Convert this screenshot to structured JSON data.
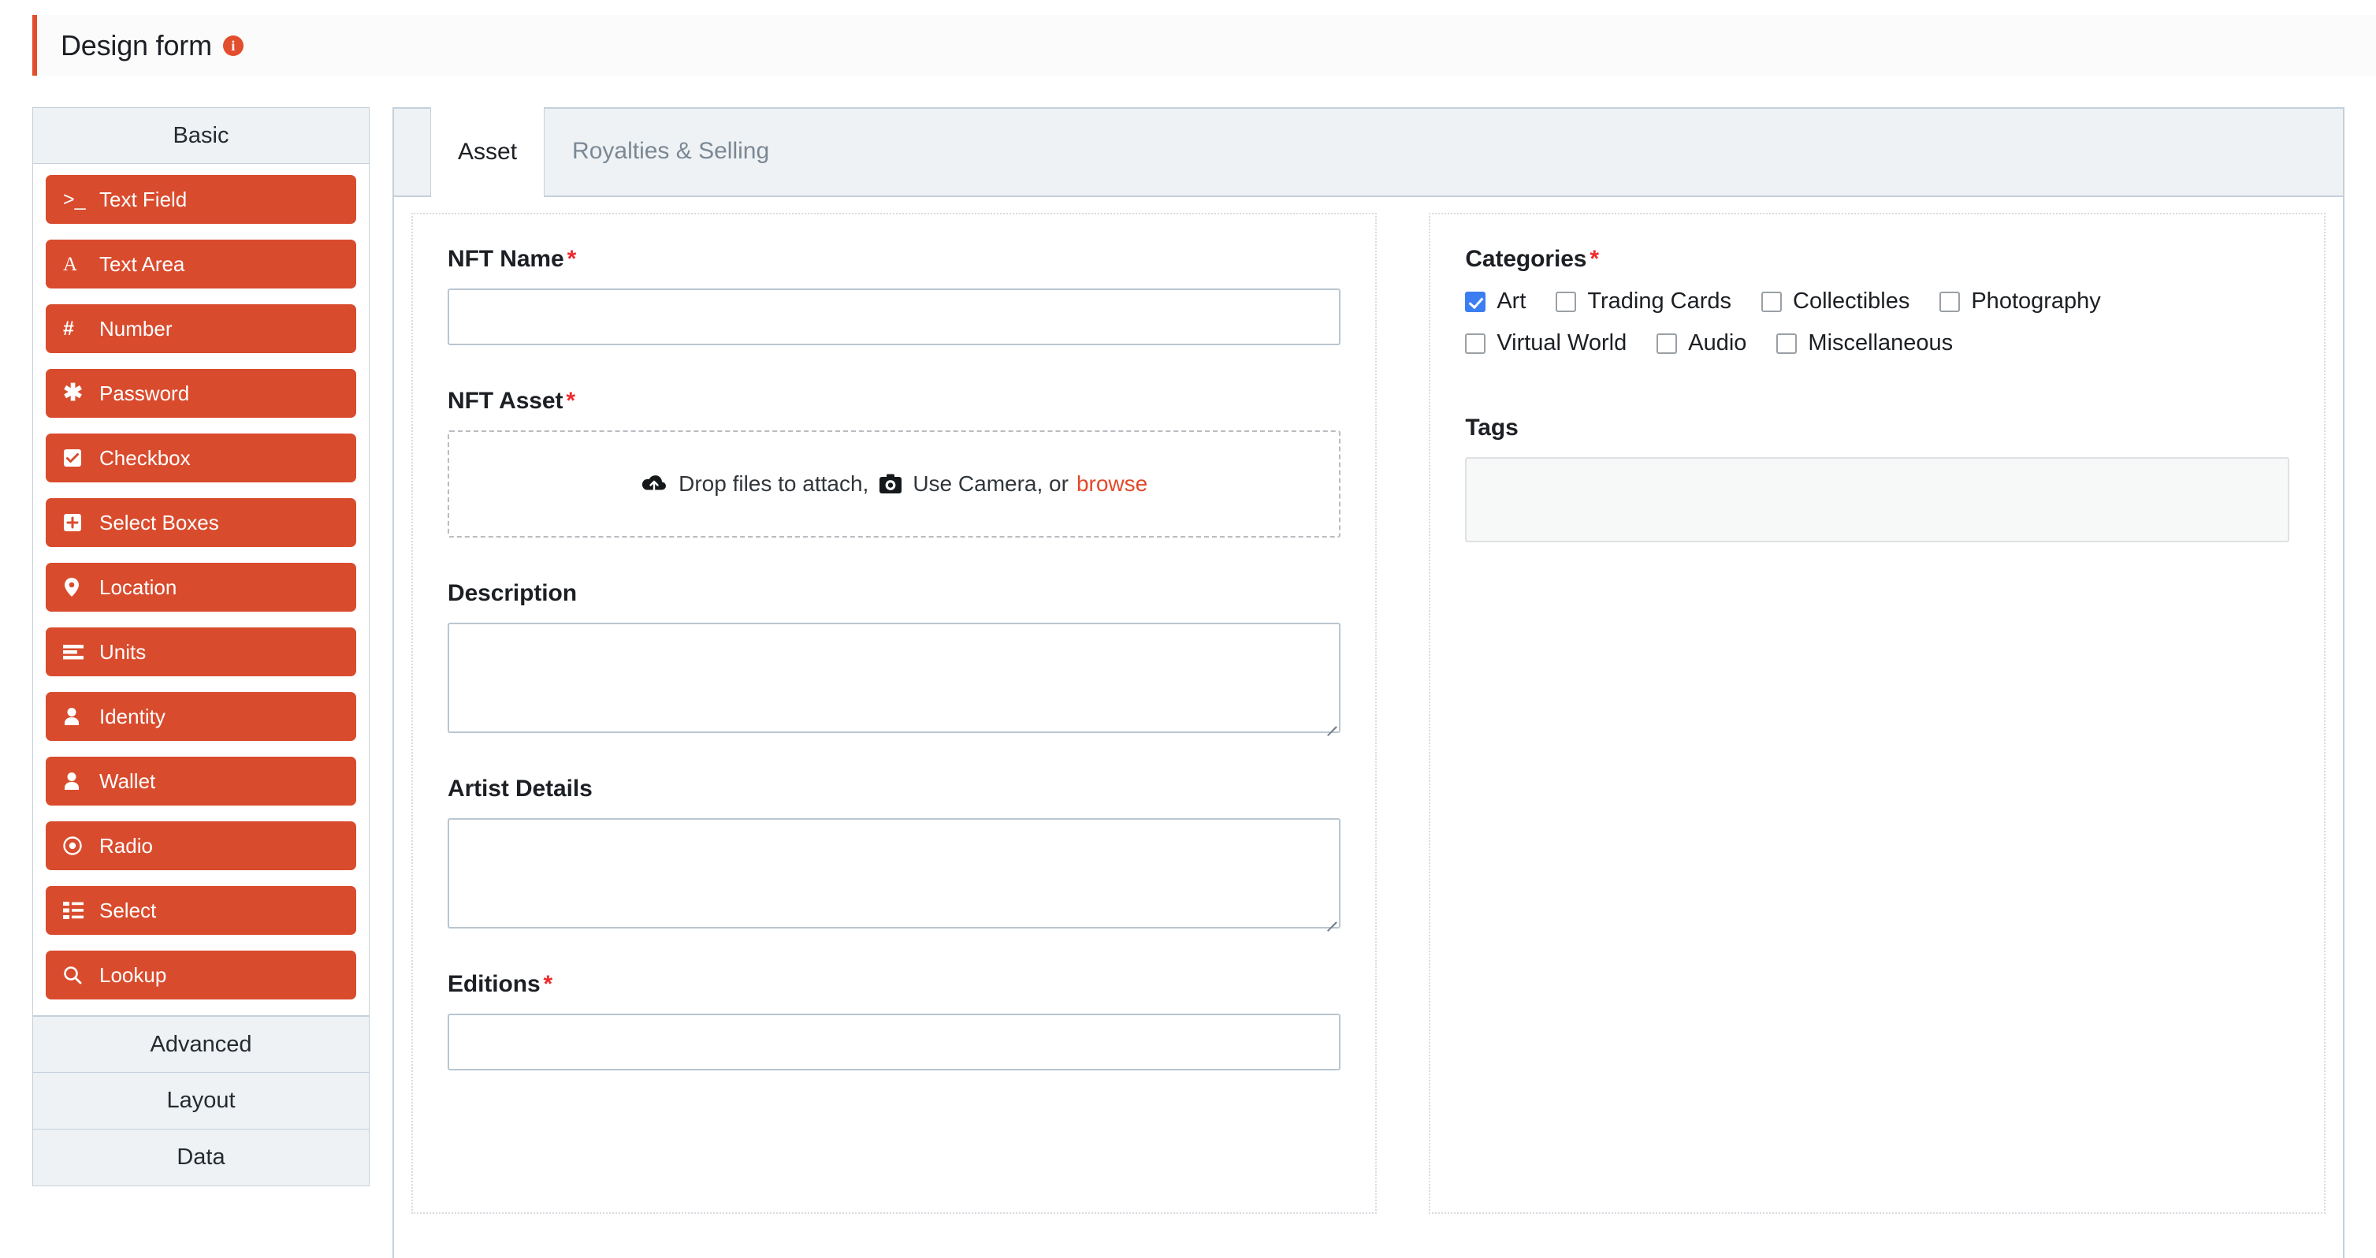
{
  "header": {
    "title": "Design form",
    "info_icon": "info-icon",
    "accent_color": "#e24d2d"
  },
  "sidebar": {
    "sections": [
      {
        "label": "Basic"
      },
      {
        "label": "Advanced"
      },
      {
        "label": "Layout"
      },
      {
        "label": "Data"
      }
    ],
    "basic_items": [
      {
        "label": "Text Field",
        "icon": "terminal-prompt-icon"
      },
      {
        "label": "Text Area",
        "icon": "letter-a-icon"
      },
      {
        "label": "Number",
        "icon": "hash-icon"
      },
      {
        "label": "Password",
        "icon": "asterisk-icon"
      },
      {
        "label": "Checkbox",
        "icon": "checkbox-icon"
      },
      {
        "label": "Select Boxes",
        "icon": "plus-square-icon"
      },
      {
        "label": "Location",
        "icon": "map-pin-icon"
      },
      {
        "label": "Units",
        "icon": "list-bars-icon"
      },
      {
        "label": "Identity",
        "icon": "person-icon"
      },
      {
        "label": "Wallet",
        "icon": "person-icon"
      },
      {
        "label": "Radio",
        "icon": "radio-dot-icon"
      },
      {
        "label": "Select",
        "icon": "list-icon"
      },
      {
        "label": "Lookup",
        "icon": "search-icon"
      }
    ],
    "button_color": "#d94b2d"
  },
  "main": {
    "tabs": [
      {
        "label": "Asset",
        "active": true
      },
      {
        "label": "Royalties & Selling",
        "active": false
      }
    ],
    "left_column": {
      "nft_name": {
        "label": "NFT Name",
        "required": "*",
        "value": ""
      },
      "nft_asset": {
        "label": "NFT Asset",
        "required": "*",
        "drop_text_1": "Drop files to attach,",
        "drop_text_2": "Use Camera, or",
        "browse_link": "browse",
        "upload_icon": "cloud-upload-icon",
        "camera_icon": "camera-icon",
        "link_color": "#e2492a"
      },
      "description": {
        "label": "Description",
        "value": ""
      },
      "artist_details": {
        "label": "Artist Details",
        "value": ""
      },
      "editions": {
        "label": "Editions",
        "required": "*",
        "value": ""
      }
    },
    "right_column": {
      "categories": {
        "label": "Categories",
        "required": "*",
        "row1": [
          {
            "label": "Art",
            "checked": true
          },
          {
            "label": "Trading Cards",
            "checked": false
          },
          {
            "label": "Collectibles",
            "checked": false
          },
          {
            "label": "Photography",
            "checked": false
          }
        ],
        "row2": [
          {
            "label": "Virtual World",
            "checked": false
          },
          {
            "label": "Audio",
            "checked": false
          },
          {
            "label": "Miscellaneous",
            "checked": false
          }
        ],
        "checked_color": "#3b7ef2"
      },
      "tags": {
        "label": "Tags",
        "value": ""
      }
    }
  }
}
